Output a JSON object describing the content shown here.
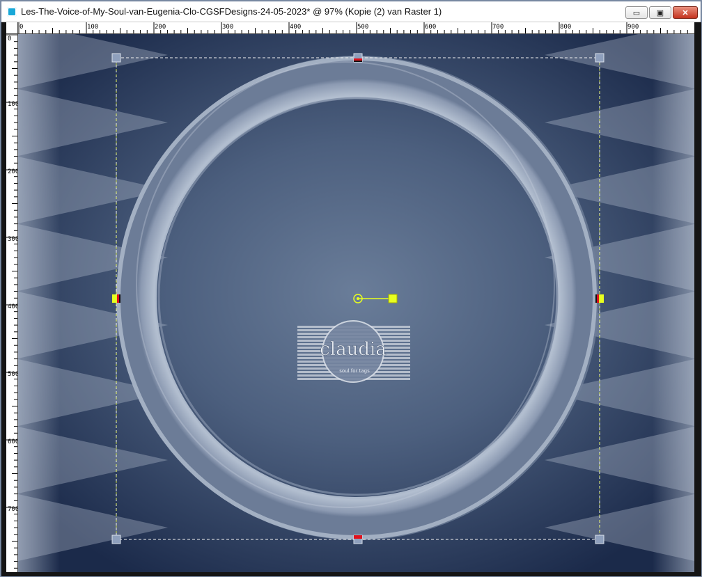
{
  "window": {
    "title": "Les-The-Voice-of-My-Soul-van-Eugenia-Clo-CGSFDesigns-24-05-2023* @  97% (Kopie (2) van Raster 1)",
    "buttons": {
      "minimize": "▭",
      "maximize": "▣",
      "close": "✕"
    }
  },
  "ruler": {
    "top_labels": [
      "0",
      "100",
      "200",
      "300",
      "400",
      "500",
      "600",
      "700",
      "800",
      "900"
    ],
    "left_labels": [
      "0",
      "100",
      "200",
      "300",
      "400",
      "500",
      "600",
      "700"
    ]
  },
  "watermark": {
    "text": "claudia",
    "subtext": "soul for tags"
  },
  "colors": {
    "canvas_center": "#6a7d99",
    "canvas_edge": "#1b2a4a",
    "ring": "#a3afc2",
    "handle": "#e8ff1f",
    "marker_red": "#e0121d",
    "handle_gray": "#8fa0bd"
  },
  "icons": {
    "app": "psp-app-icon"
  }
}
